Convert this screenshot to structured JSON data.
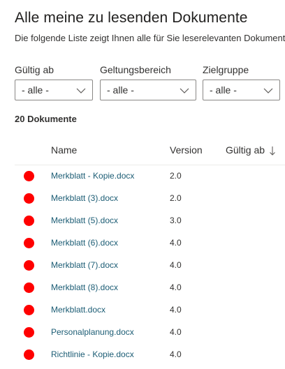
{
  "page": {
    "title": "Alle meine zu lesenden Dokumente",
    "subtitle": "Die folgende Liste zeigt Ihnen alle für Sie leserelevanten Dokumente"
  },
  "filters": [
    {
      "label": "Gültig ab",
      "value": "- alle -"
    },
    {
      "label": "Geltungsbereich",
      "value": "- alle -"
    },
    {
      "label": "Zielgruppe",
      "value": "- alle -"
    }
  ],
  "list": {
    "count_label": "20 Dokumente",
    "columns": {
      "name": "Name",
      "version": "Version",
      "valid_from": "Gültig ab"
    },
    "sort": {
      "column": "valid_from",
      "direction": "descending",
      "icon": "arrow-down-icon"
    },
    "status_color": "#ff0000",
    "link_color": "#1b5c74",
    "rows": [
      {
        "name": "Merkblatt - Kopie.docx",
        "version": "2.0",
        "valid_from": ""
      },
      {
        "name": "Merkblatt (3).docx",
        "version": "2.0",
        "valid_from": ""
      },
      {
        "name": "Merkblatt (5).docx",
        "version": "3.0",
        "valid_from": ""
      },
      {
        "name": "Merkblatt (6).docx",
        "version": "4.0",
        "valid_from": ""
      },
      {
        "name": "Merkblatt (7).docx",
        "version": "4.0",
        "valid_from": ""
      },
      {
        "name": "Merkblatt (8).docx",
        "version": "4.0",
        "valid_from": ""
      },
      {
        "name": "Merkblatt.docx",
        "version": "4.0",
        "valid_from": ""
      },
      {
        "name": "Personalplanung.docx",
        "version": "4.0",
        "valid_from": ""
      },
      {
        "name": "Richtlinie - Kopie.docx",
        "version": "4.0",
        "valid_from": ""
      }
    ]
  },
  "icons": {
    "dropdown": "chevron-down-icon",
    "status": "status-dot-icon"
  }
}
